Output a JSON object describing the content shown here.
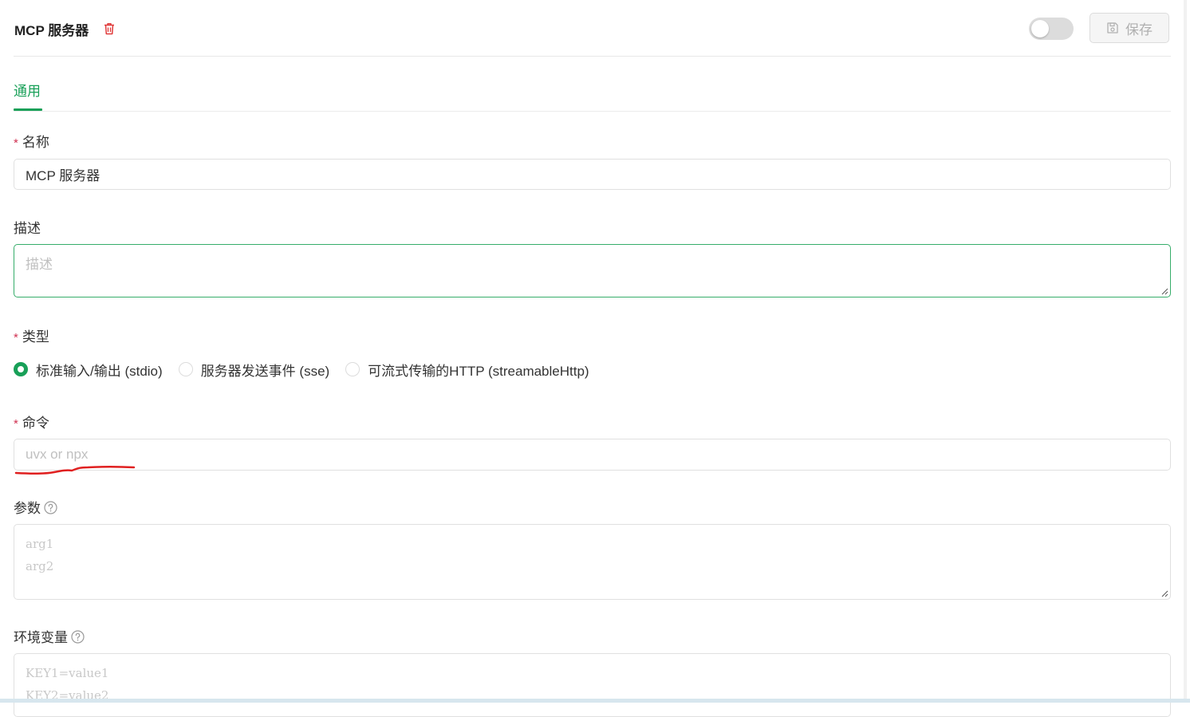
{
  "header": {
    "title": "MCP 服务器",
    "save_label": "保存",
    "enabled": false
  },
  "tabs": [
    {
      "label": "通用",
      "active": true
    }
  ],
  "form": {
    "name": {
      "label": "名称",
      "required": true,
      "value": "MCP 服务器"
    },
    "description": {
      "label": "描述",
      "placeholder": "描述",
      "value": ""
    },
    "type": {
      "label": "类型",
      "required": true,
      "options": [
        {
          "label": "标准输入/输出 (stdio)",
          "checked": true
        },
        {
          "label": "服务器发送事件 (sse)",
          "checked": false
        },
        {
          "label": "可流式传输的HTTP (streamableHttp)",
          "checked": false
        }
      ]
    },
    "command": {
      "label": "命令",
      "required": true,
      "placeholder": "uvx or npx",
      "value": ""
    },
    "args": {
      "label": "参数",
      "placeholder_lines": [
        "arg1",
        "arg2"
      ]
    },
    "env": {
      "label": "环境变量",
      "placeholder_lines": [
        "KEY1=value1",
        "KEY2=value2"
      ]
    }
  },
  "colors": {
    "accent": "#18a058",
    "required": "#d03050",
    "danger": "#e03a3a",
    "annotation": "#e02020"
  },
  "icons": {
    "delete": "trash-icon",
    "save": "floppy-disk-icon",
    "help": "question-circle-icon"
  }
}
